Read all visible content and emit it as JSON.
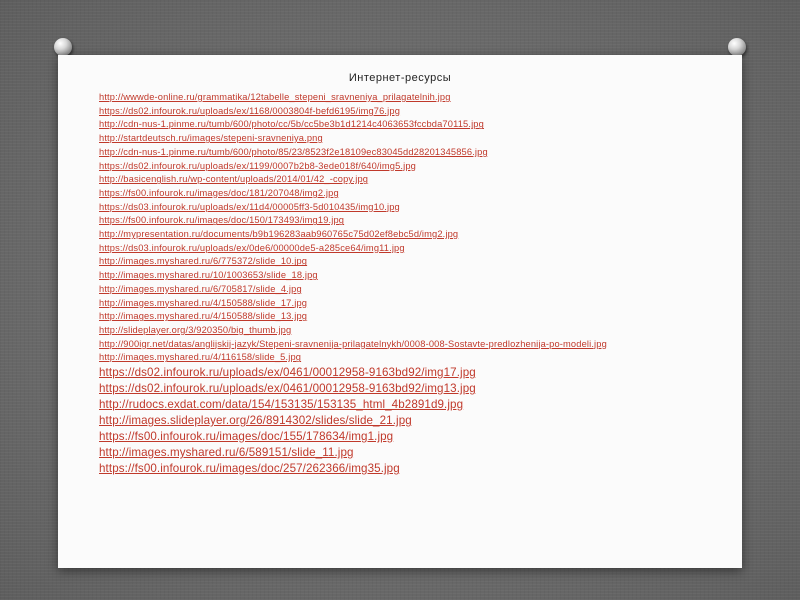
{
  "slide": {
    "title": "Интернет-ресурсы",
    "links_small": [
      "http://wwwde-online.ru/grammatika/12tabelle_stepeni_sravneniya_prilagatelnih.jpg",
      "https://ds02.infourok.ru/uploads/ex/1168/0003804f-befd6195/img76.jpg",
      "http://cdn-nus-1.pinme.ru/tumb/600/photo/cc/5b/cc5be3b1d1214c4063653fccbda70115.jpg",
      "http://startdeutsch.ru/images/stepeni-sravneniya.png",
      "http://cdn-nus-1.pinme.ru/tumb/600/photo/85/23/8523f2e18109ec83045dd28201345856.jpg",
      "https://ds02.infourok.ru/uploads/ex/1199/0007b2b8-3ede018f/640/img5.jpg",
      "http://basicenglish.ru/wp-content/uploads/2014/01/42_-copy.jpg",
      "https://fs00.infourok.ru/images/doc/181/207048/img2.jpg",
      "https://ds03.infourok.ru/uploads/ex/11d4/00005ff3-5d010435/img10.jpg",
      "https://fs00.infourok.ru/images/doc/150/173493/img19.jpg",
      "http://mypresentation.ru/documents/b9b196283aab960765c75d02ef8ebc5d/img2.jpg",
      "https://ds03.infourok.ru/uploads/ex/0de6/00000de5-a285ce64/img11.jpg",
      "http://images.myshared.ru/6/775372/slide_10.jpg",
      "http://images.myshared.ru/10/1003653/slide_18.jpg",
      "http://images.myshared.ru/6/705817/slide_4.jpg",
      "http://images.myshared.ru/4/150588/slide_17.jpg",
      "http://images.myshared.ru/4/150588/slide_13.jpg",
      "http://slideplayer.org/3/920350/big_thumb.jpg",
      "http://900igr.net/datas/anglijskij-jazyk/Stepeni-sravnenija-prilagatelnykh/0008-008-Sostavte-predlozhenija-po-modeli.jpg",
      "http://images.myshared.ru/4/116158/slide_5.jpg"
    ],
    "links_large": [
      "https://ds02.infourok.ru/uploads/ex/0461/00012958-9163bd92/img17.jpg",
      "https://ds02.infourok.ru/uploads/ex/0461/00012958-9163bd92/img13.jpg",
      "http://rudocs.exdat.com/data/154/153135/153135_html_4b2891d9.jpg",
      "http://images.slideplayer.org/26/8914302/slides/slide_21.jpg",
      "https://fs00.infourok.ru/images/doc/155/178634/img1.jpg",
      "http://images.myshared.ru/6/589151/slide_11.jpg",
      "https://fs00.infourok.ru/images/doc/257/262366/img35.jpg"
    ],
    "colors": {
      "link": "#c0392b",
      "paper": "#fbfbfb",
      "background": "#6f6f6f"
    },
    "icons": [
      "pushpin-icon",
      "pushpin-icon"
    ]
  }
}
